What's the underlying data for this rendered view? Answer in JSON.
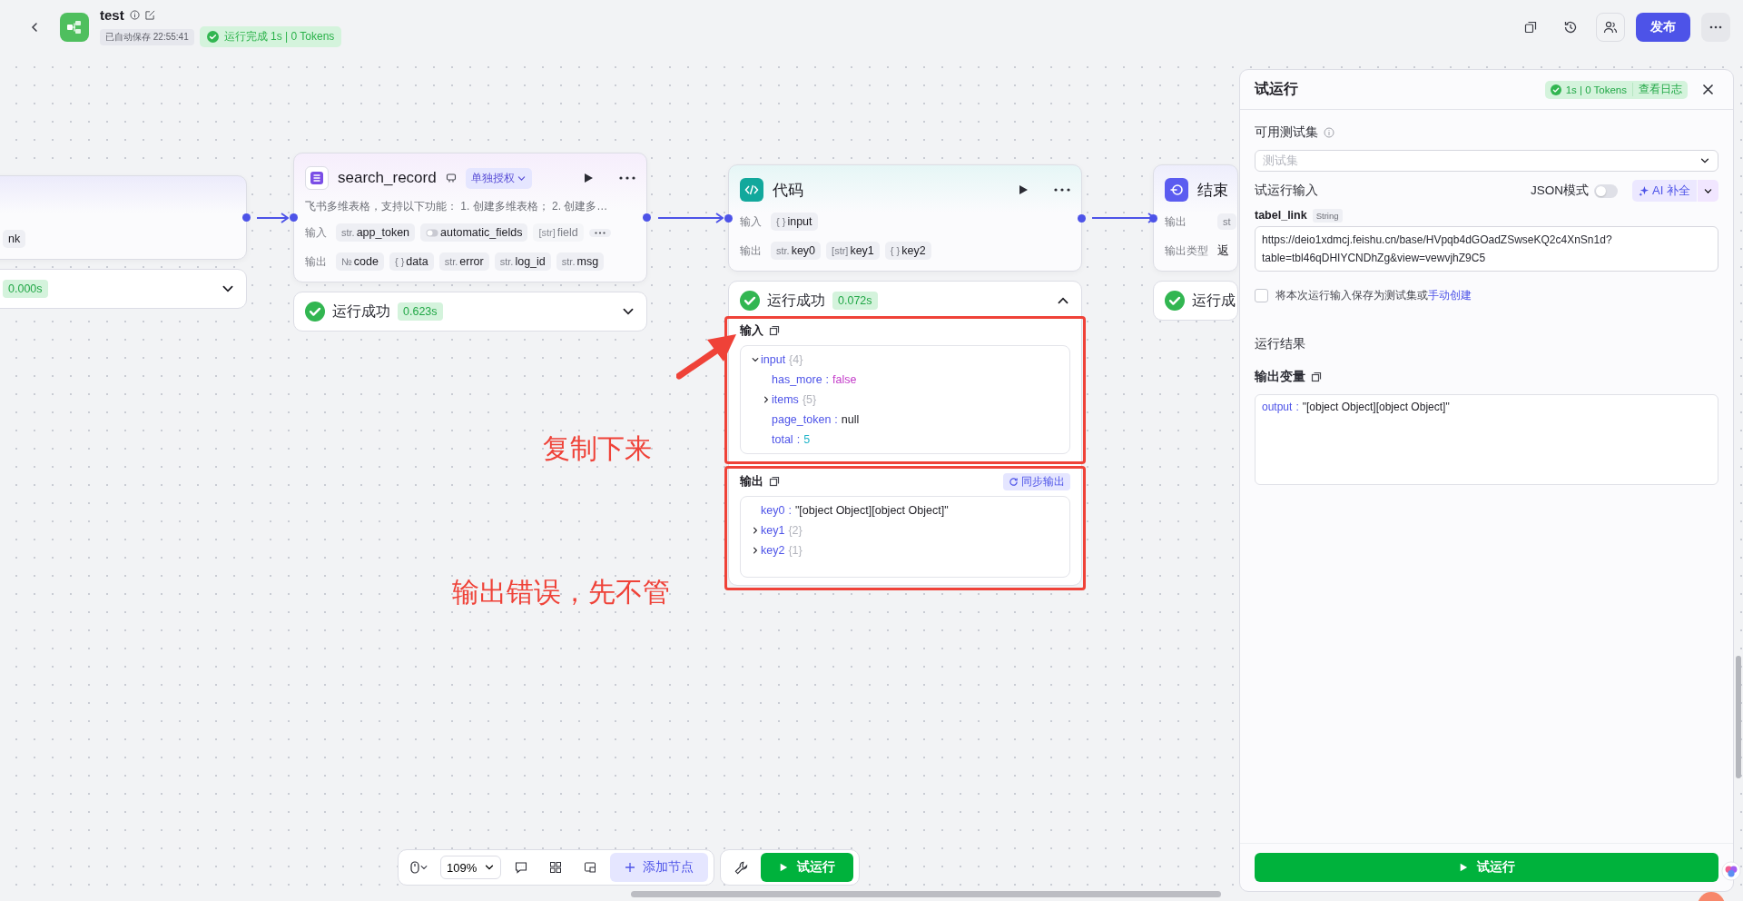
{
  "header": {
    "title": "test",
    "autosave": "已自动保存 22:55:41",
    "status": "运行完成 1s | 0 Tokens",
    "publish": "发布"
  },
  "nodes": [
    {
      "kind": "partial",
      "rows": [
        {
          "chips": [
            {
              "name": "nk"
            }
          ]
        }
      ],
      "result": {
        "time": "0.000s",
        "expanded": false
      }
    },
    {
      "kind": "plugin",
      "title": "search_record",
      "auth": "单独授权",
      "description": "飞书多维表格，支持以下功能： 1. 创建多维表格； 2. 创建多…",
      "rows": [
        {
          "label": "输入",
          "more": true,
          "chips": [
            {
              "kind": "typed",
              "prefix": "str.",
              "name": "app_token",
              "disabled": false
            },
            {
              "kind": "toggle",
              "name": "automatic_fields",
              "disabled": false
            },
            {
              "kind": "typed",
              "prefix": "[str]",
              "name": "field",
              "disabled": true
            }
          ]
        },
        {
          "label": "输出",
          "chips": [
            {
              "kind": "typed",
              "prefix": "№",
              "name": "code"
            },
            {
              "kind": "typed",
              "prefix": "{ }",
              "name": "data"
            },
            {
              "kind": "typed",
              "prefix": "str.",
              "name": "error"
            },
            {
              "kind": "typed",
              "prefix": "str.",
              "name": "log_id"
            },
            {
              "kind": "typed",
              "prefix": "str.",
              "name": "msg"
            }
          ]
        }
      ],
      "result": {
        "succeeded": true,
        "label": "运行成功",
        "time": "0.623s",
        "expanded": false
      }
    },
    {
      "kind": "code",
      "title": "代码",
      "rows": [
        {
          "label": "输入",
          "chips": [
            {
              "kind": "typed",
              "prefix": "{ }",
              "name": "input"
            }
          ]
        },
        {
          "label": "输出",
          "chips": [
            {
              "kind": "typed",
              "prefix": "str.",
              "name": "key0"
            },
            {
              "kind": "typed",
              "prefix": "[str]",
              "name": "key1"
            },
            {
              "kind": "typed",
              "prefix": "{ }",
              "name": "key2"
            }
          ]
        }
      ],
      "result": {
        "succeeded": true,
        "label": "运行成功",
        "time": "0.072s",
        "expanded": true,
        "input": {
          "title": "输入",
          "tree": [
            {
              "key": "input",
              "kind": "object",
              "count": "{4}",
              "expanded": true,
              "children": [
                {
                  "key": "has_more",
                  "kind": "boolean",
                  "separator": ":",
                  "value": "false"
                },
                {
                  "key": "items",
                  "kind": "object",
                  "count": "{5}",
                  "expanded": false
                },
                {
                  "key": "page_token",
                  "kind": "null",
                  "separator": ":",
                  "value": "null"
                },
                {
                  "key": "total",
                  "kind": "number",
                  "separator": ":",
                  "value": "5"
                }
              ]
            }
          ]
        },
        "output": {
          "title": "输出",
          "sync": "同步输出",
          "tree": [
            {
              "key": "key0",
              "kind": "string",
              "separator": ":",
              "value": "\"[object Object][object Object]\""
            },
            {
              "key": "key1",
              "kind": "object",
              "count": "{2}",
              "expanded": false
            },
            {
              "key": "key2",
              "kind": "object",
              "count": "{1}",
              "expanded": false
            }
          ]
        }
      }
    },
    {
      "kind": "end",
      "title": "结束",
      "rows": [
        {
          "label": "输出",
          "chips": [
            {
              "kind": "typed",
              "prefix": "st"
            }
          ]
        },
        {
          "label": "输出类型",
          "text": "返"
        }
      ],
      "result": {
        "succeeded": true,
        "label": "运行成"
      }
    }
  ],
  "annotations": [
    {
      "text": "复制下来"
    },
    {
      "text": "输出错误，先不管"
    }
  ],
  "toolbar": {
    "zoom": "109%",
    "add_node": "添加节点",
    "run": "试运行"
  },
  "panel": {
    "title": "试运行",
    "status": "1s | 0 Tokens",
    "log_link": "查看日志",
    "testset_label": "可用测试集",
    "testset_placeholder": "测试集",
    "input_label": "试运行输入",
    "json_mode": {
      "label": "JSON模式",
      "on": false
    },
    "ai_button": "AI 补全",
    "fields": [
      {
        "name": "tabel_link",
        "type": "String",
        "value": "https://deio1xdmcj.feishu.cn/base/HVpqb4dGOadZSwseKQ2c4XnSn1d?table=tbl46qDHIYCNDhZg&view=vewvjhZ9C5"
      }
    ],
    "save": {
      "checked": false,
      "text": "将本次运行输入保存为测试集或",
      "link": "手动创建"
    },
    "result_label": "运行结果",
    "output_label": "输出变量",
    "outputs": [
      {
        "key": "output",
        "separator": ":",
        "value": "\"[object Object][object Object]\""
      }
    ],
    "run_button": "试运行"
  }
}
